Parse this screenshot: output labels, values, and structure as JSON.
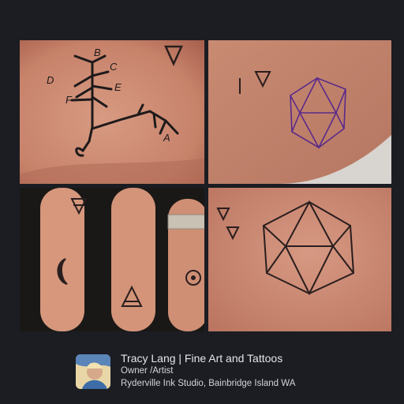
{
  "post": {
    "author_name": "Tracy Lang | Fine Art and Tattoos",
    "role": "Owner /Artist",
    "studio": "Ryderville Ink Studio, Bainbridge Island WA"
  },
  "photos": [
    {
      "subject": "hand-tree-tattoo",
      "handwritten_letters": [
        "B",
        "C",
        "D",
        "A",
        "E",
        "F"
      ]
    },
    {
      "subject": "icosahedron-outline-tattoo"
    },
    {
      "subject": "finger-alchemical-symbols-tattoo"
    },
    {
      "subject": "icosahedron-healed-tattoo"
    }
  ],
  "colors": {
    "background": "#1b1d22",
    "skin": "#c98a72",
    "ink": "#1e1a1a",
    "ink_purple": "#5a2a8a"
  }
}
